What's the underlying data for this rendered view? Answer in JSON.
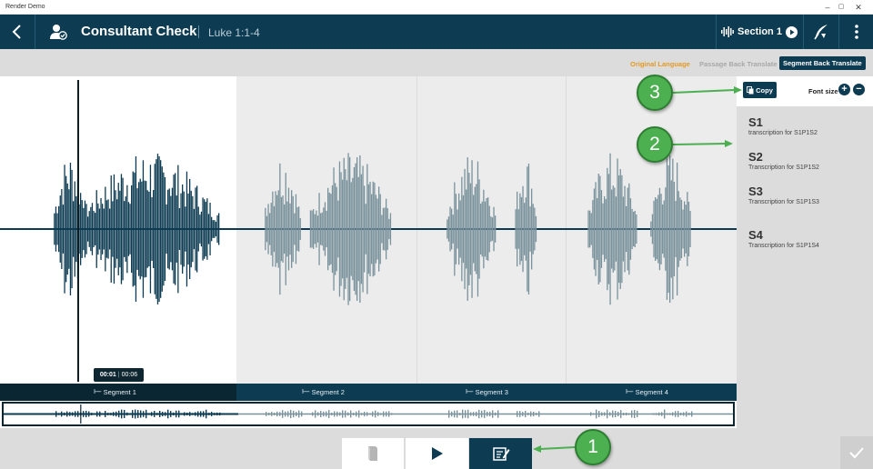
{
  "window": {
    "title": "Render Demo",
    "controls": [
      "–",
      "▢",
      "✕"
    ]
  },
  "header": {
    "title": "Consultant Check",
    "reference": "Luke 1:1-4",
    "section_label": "Section 1"
  },
  "view_tabs": [
    {
      "label": "Original Language",
      "state": "highlighted"
    },
    {
      "label": "Passage Back Translate",
      "state": "disabled"
    },
    {
      "label": "Segment Back Translate",
      "state": "selected"
    }
  ],
  "player": {
    "current_time": "00:01",
    "total_time": "00:06",
    "progress": 0.105
  },
  "segments": [
    "Segment 1",
    "Segment 2",
    "Segment 3",
    "Segment 4"
  ],
  "transcript": {
    "copy_label": "Copy",
    "font_size_label": "Font size",
    "items": [
      {
        "heading": "S1",
        "text": "transcription for S1P1S2"
      },
      {
        "heading": "S2",
        "text": "Transcription for S1P1S2"
      },
      {
        "heading": "S3",
        "text": "Transcription for S1P1S3"
      },
      {
        "heading": "S4",
        "text": "Transcription for S1P1S4"
      }
    ]
  },
  "callouts": [
    "1",
    "2",
    "3"
  ],
  "colors": {
    "header_bg": "#0c3b52",
    "waveform_active": "#0c3b52",
    "waveform_inactive": "#7a929b",
    "accent_orange": "#e59a1e",
    "callout_green": "#4caf50"
  },
  "icons": {
    "back": "chevron-left-icon",
    "consultant": "user-check-icon",
    "section_audio": "audio-waveform-icon",
    "section_play": "play-circle-icon",
    "tool": "quill-icon",
    "menu": "kebab-menu-icon",
    "book": "book-icon",
    "play": "play-icon",
    "edit": "note-edit-icon",
    "confirm": "checkmark-icon"
  }
}
